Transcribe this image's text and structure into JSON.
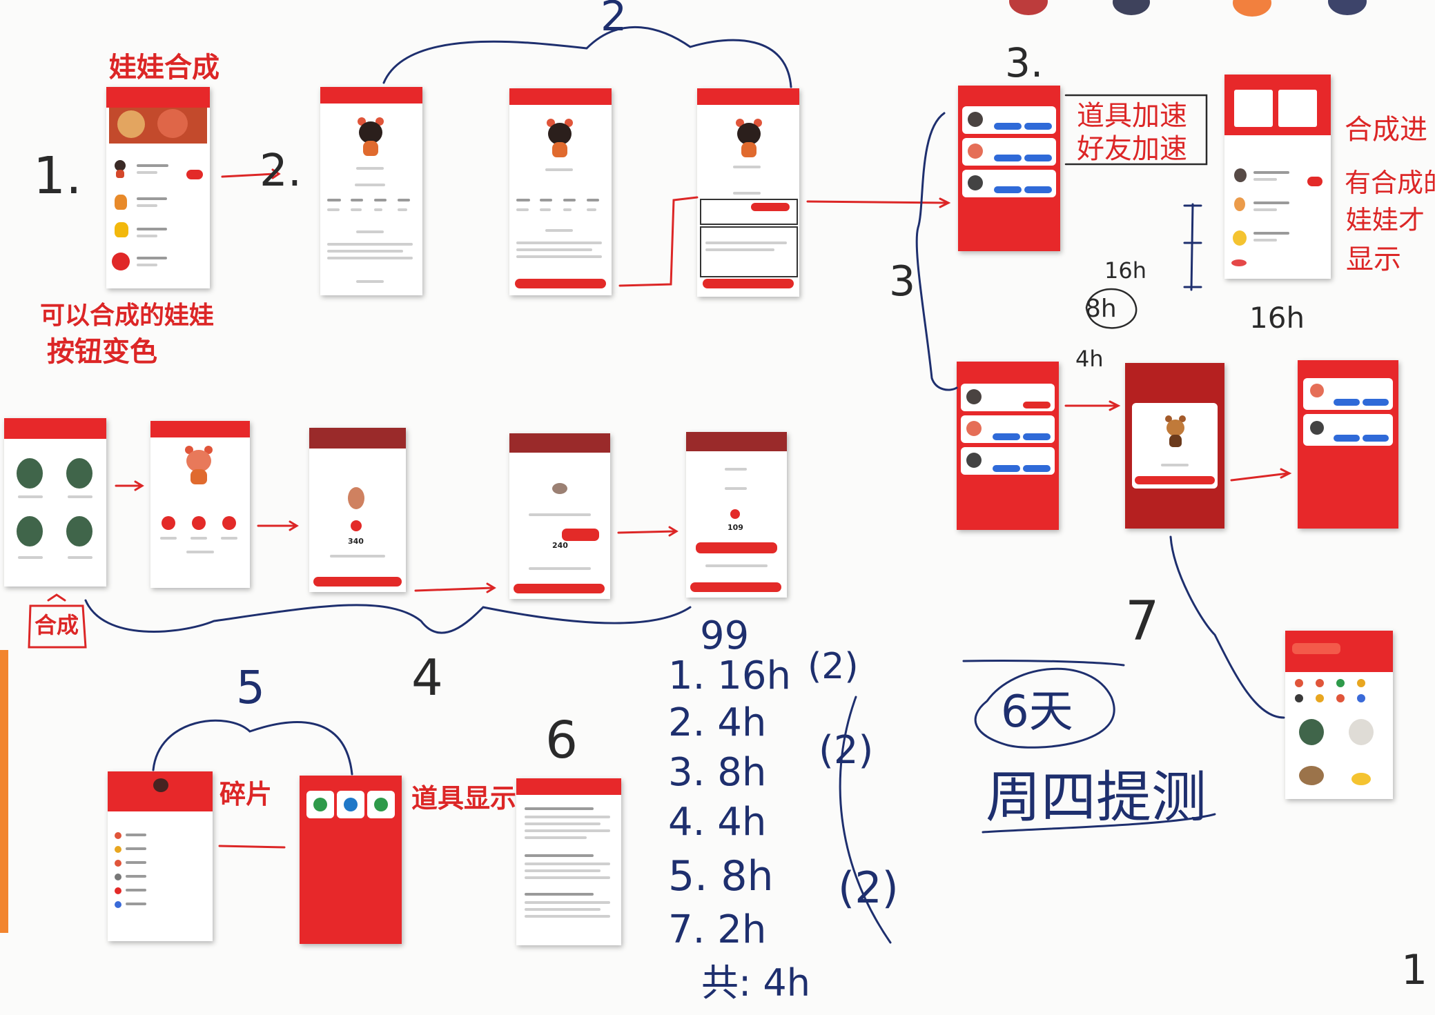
{
  "colors": {
    "marker_red": "#dc2626",
    "marker_blue": "#1e2f6e",
    "marker_black": "#2a2a2a",
    "screen_red": "#e7282a",
    "button_blue": "#2f6ad8",
    "board_white": "#fbfbfa"
  },
  "notes": {
    "doll_synthesis": "娃娃合成",
    "can_synthesize_line1": "可以合成的娃娃",
    "can_synthesize_line2": "按钮变色",
    "prop_speedup": "道具加速",
    "friend_speedup": "好友加速",
    "synth_progress": "合成进",
    "only_show_line1": "有合成的",
    "only_show_line2": "娃娃才",
    "only_show_line3": "显示",
    "fragments": "碎片",
    "props_display": "道具显示",
    "synth_badge": "合成",
    "six_days": "6天",
    "thursday_test": "周四提测"
  },
  "numbers": {
    "n1": "1.",
    "n2": "2.",
    "n3": "3.",
    "n3b": "3",
    "n4": "4",
    "n5": "5",
    "n6": "6",
    "n7": "7",
    "c2": "2",
    "h16_side": "16h",
    "h16_small": "16h",
    "h8_small": "8h",
    "h4_small": "4h",
    "slash_one": "1"
  },
  "estimates": [
    {
      "label": "1. 16h",
      "note": "(2)"
    },
    {
      "label": "2. 4h",
      "note": "(2)"
    },
    {
      "label": "3. 8h",
      "note": ""
    },
    {
      "label": "4. 4h",
      "note": ""
    },
    {
      "label": "5. 8h",
      "note": "(2)"
    },
    {
      "label": "7. 2h",
      "note": ""
    },
    {
      "label": "共: 4h",
      "note": ""
    }
  ],
  "screen_numbers": {
    "val_340": "340",
    "val_240": "240",
    "val_109": "109"
  },
  "tallies": {
    "gg": "99"
  }
}
